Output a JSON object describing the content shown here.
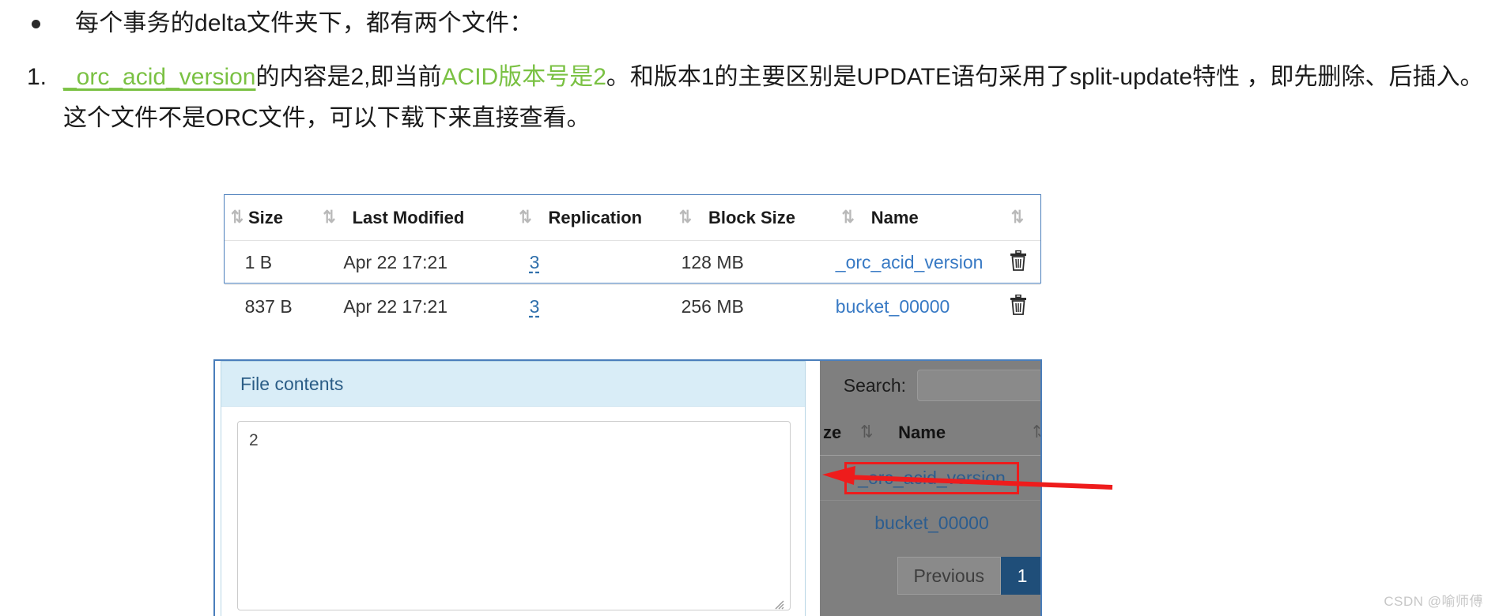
{
  "article": {
    "bullet_text": "每个事务的delta文件夹下，都有两个文件：",
    "list_number": "1.",
    "ol_part1": "_orc_acid_version",
    "ol_part2": "的内容是2,即当前",
    "ol_part3": "ACID版本号是2",
    "ol_part4": "。和版本1的主要区别是UPDATE语句采用了split-update特性",
    "ol_line2": "，即先删除、后插入。这个文件不是ORC文件，可以下载下来直接查看。",
    "accent_green": "#7ac143"
  },
  "file_table": {
    "columns": [
      "Size",
      "Last Modified",
      "Replication",
      "Block Size",
      "Name"
    ],
    "sort_icon": "⇅",
    "rows": [
      {
        "size": "1 B",
        "last_modified": "Apr 22 17:21",
        "replication": "3",
        "block_size": "128 MB",
        "name": "_orc_acid_version",
        "delete_icon": "trash-icon"
      },
      {
        "size": "837 B",
        "last_modified": "Apr 22 17:21",
        "replication": "3",
        "block_size": "256 MB",
        "name": "bucket_00000",
        "delete_icon": "trash-icon"
      }
    ],
    "border_color": "#4a7ebb",
    "link_color": "#3779c4"
  },
  "modal": {
    "title": "File contents",
    "textarea_value": "2",
    "textarea_placeholder": "",
    "header_bg": "#d9edf7",
    "title_color": "#2b5d86"
  },
  "dim_panel": {
    "search_label": "Search:",
    "search_value": "",
    "search_placeholder": "",
    "col_size_partial": "ze",
    "col_name": "Name",
    "sort_icon": "⇅",
    "rows": [
      {
        "name": "_orc_acid_version",
        "highlighted": true
      },
      {
        "name": "bucket_00000",
        "highlighted": false
      }
    ],
    "pager": {
      "previous_label": "Previous",
      "page_label": "1"
    },
    "overlay_color": "#7f7f7f",
    "highlight_color": "#ee1c1c",
    "active_page_bg": "#1f4e79"
  },
  "annotation": {
    "arrow_color": "#ee1c1c",
    "arrow_description": "red-arrow-pointing-left"
  },
  "watermark": {
    "text": "CSDN @喻师傅"
  }
}
